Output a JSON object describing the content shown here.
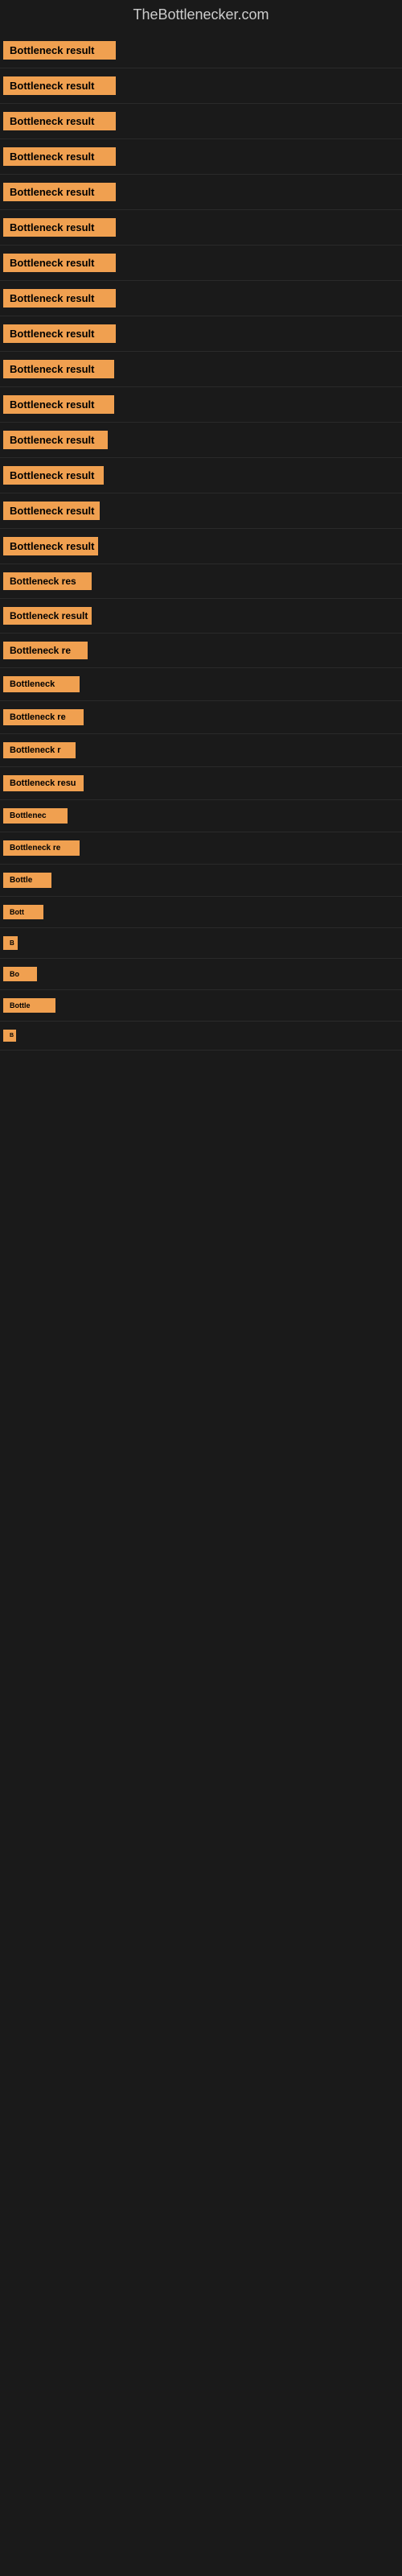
{
  "site": {
    "title": "TheBottlenecker.com"
  },
  "rows": [
    {
      "id": 1,
      "label": "Bottleneck result"
    },
    {
      "id": 2,
      "label": "Bottleneck result"
    },
    {
      "id": 3,
      "label": "Bottleneck result"
    },
    {
      "id": 4,
      "label": "Bottleneck result"
    },
    {
      "id": 5,
      "label": "Bottleneck result"
    },
    {
      "id": 6,
      "label": "Bottleneck result"
    },
    {
      "id": 7,
      "label": "Bottleneck result"
    },
    {
      "id": 8,
      "label": "Bottleneck result"
    },
    {
      "id": 9,
      "label": "Bottleneck result"
    },
    {
      "id": 10,
      "label": "Bottleneck result"
    },
    {
      "id": 11,
      "label": "Bottleneck result"
    },
    {
      "id": 12,
      "label": "Bottleneck result"
    },
    {
      "id": 13,
      "label": "Bottleneck result"
    },
    {
      "id": 14,
      "label": "Bottleneck result"
    },
    {
      "id": 15,
      "label": "Bottleneck result"
    },
    {
      "id": 16,
      "label": "Bottleneck res"
    },
    {
      "id": 17,
      "label": "Bottleneck result"
    },
    {
      "id": 18,
      "label": "Bottleneck re"
    },
    {
      "id": 19,
      "label": "Bottleneck"
    },
    {
      "id": 20,
      "label": "Bottleneck re"
    },
    {
      "id": 21,
      "label": "Bottleneck r"
    },
    {
      "id": 22,
      "label": "Bottleneck resu"
    },
    {
      "id": 23,
      "label": "Bottlenec"
    },
    {
      "id": 24,
      "label": "Bottleneck re"
    },
    {
      "id": 25,
      "label": "Bottle"
    },
    {
      "id": 26,
      "label": "Bott"
    },
    {
      "id": 27,
      "label": "B"
    },
    {
      "id": 28,
      "label": "Bo"
    },
    {
      "id": 29,
      "label": "Bottle"
    },
    {
      "id": 30,
      "label": "B"
    }
  ],
  "colors": {
    "badge_bg": "#f0a050",
    "badge_text": "#000000",
    "page_bg": "#1a1a1a",
    "title_color": "#cccccc"
  }
}
